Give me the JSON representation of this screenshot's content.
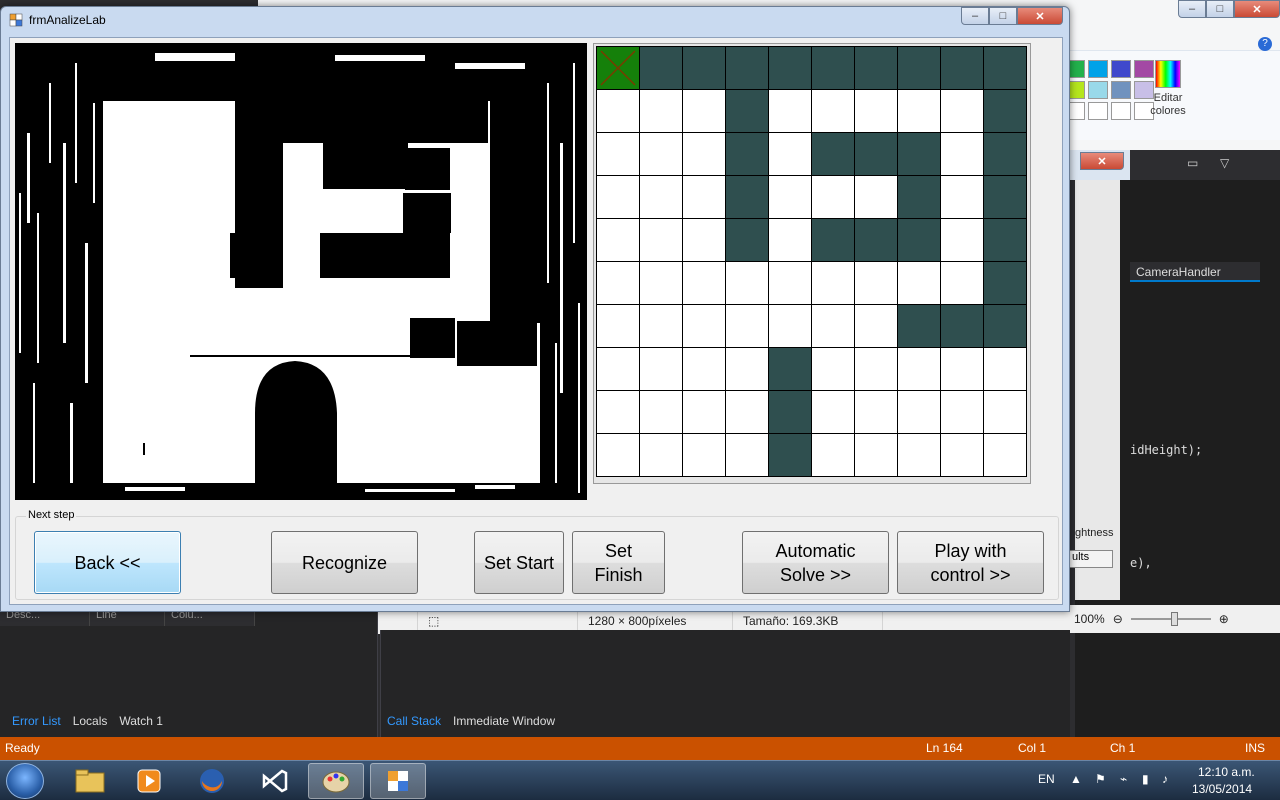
{
  "window": {
    "title": "frmAnalizeLab",
    "controls": [
      "minimize",
      "maximize",
      "close"
    ]
  },
  "maze": {
    "rows": 10,
    "cols": 10,
    "walls": [
      [
        0,
        1
      ],
      [
        0,
        2
      ],
      [
        0,
        3
      ],
      [
        0,
        4
      ],
      [
        0,
        5
      ],
      [
        0,
        6
      ],
      [
        0,
        7
      ],
      [
        0,
        8
      ],
      [
        0,
        9
      ],
      [
        1,
        3
      ],
      [
        1,
        9
      ],
      [
        2,
        3
      ],
      [
        2,
        5
      ],
      [
        2,
        6
      ],
      [
        2,
        7
      ],
      [
        2,
        9
      ],
      [
        3,
        3
      ],
      [
        3,
        7
      ],
      [
        3,
        9
      ],
      [
        4,
        3
      ],
      [
        4,
        5
      ],
      [
        4,
        6
      ],
      [
        4,
        7
      ],
      [
        4,
        9
      ],
      [
        5,
        9
      ],
      [
        6,
        7
      ],
      [
        6,
        8
      ],
      [
        6,
        9
      ],
      [
        7,
        4
      ],
      [
        8,
        4
      ],
      [
        9,
        4
      ]
    ],
    "start": [
      0,
      0
    ]
  },
  "controls": {
    "group_label": "Next step",
    "back": "Back <<",
    "recognize": "Recognize",
    "set_start": "Set Start",
    "set_finish": "Set\nFinish",
    "auto_solve": "Automatic\nSolve >>",
    "play_control": "Play with\ncontrol >>"
  },
  "paint": {
    "edit_colors": "Editar\ncolores",
    "image_size": "1280 × 800píxeles",
    "file_size": "Tamaño: 169.3KB",
    "zoom": "100%"
  },
  "ide": {
    "columns": [
      "Desc...",
      "Line",
      "Colu..."
    ],
    "left_tabs": [
      "Error List",
      "Locals",
      "Watch 1"
    ],
    "middle_tabs": [
      "Call Stack",
      "Immediate Window"
    ],
    "code_tab": "CameraHandler",
    "code_line_1": "idHeight);",
    "code_line_2": "e),",
    "side_label_1": "ghtness",
    "side_label_2": "ults",
    "status": {
      "ready": "Ready",
      "ln": "Ln 164",
      "col": "Col 1",
      "ch": "Ch 1",
      "ins": "INS"
    }
  },
  "taskbar": {
    "language": "EN",
    "time": "12:10 a.m.",
    "date": "13/05/2014",
    "apps": [
      "explorer",
      "media-player",
      "firefox",
      "visual-studio",
      "paint",
      "winforms-app"
    ]
  },
  "colors": {
    "wall": "#2f4f4f",
    "start": "#15800a",
    "statusbar": "#ca5100"
  }
}
